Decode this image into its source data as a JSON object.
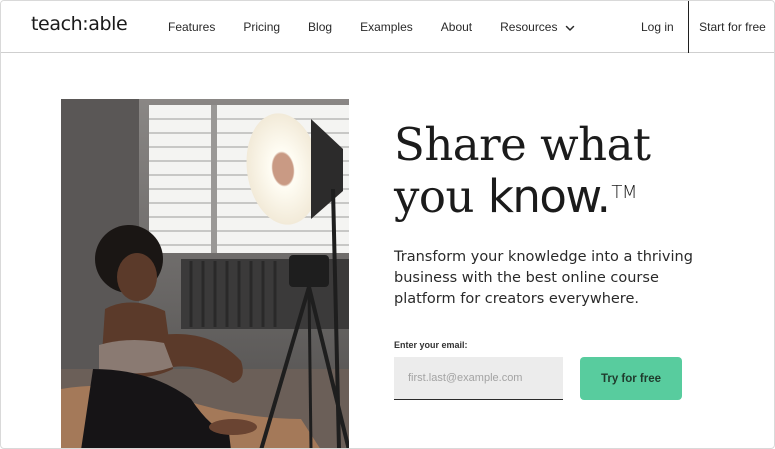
{
  "header": {
    "logo_text": "teach:able",
    "nav": [
      {
        "label": "Features"
      },
      {
        "label": "Pricing"
      },
      {
        "label": "Blog"
      },
      {
        "label": "Examples"
      },
      {
        "label": "About"
      },
      {
        "label": "Resources",
        "has_dropdown": true
      }
    ],
    "login_label": "Log in",
    "start_label": "Start for free"
  },
  "hero": {
    "headline_line1": "Share what",
    "headline_line2_plain": "you ",
    "headline_line2_bold": "know.",
    "trademark": "TM",
    "subtext": "Transform your knowledge into a thriving business with the best online course platform for creators everywhere.",
    "email_label": "Enter your email:",
    "email_placeholder": "first.last@example.com",
    "cta_label": "Try for free",
    "image_description_icon": "woman-with-ring-light-photo"
  },
  "colors": {
    "cta_bg": "#58cc9e",
    "input_bg": "#ececec",
    "text": "#1b1b1b"
  }
}
